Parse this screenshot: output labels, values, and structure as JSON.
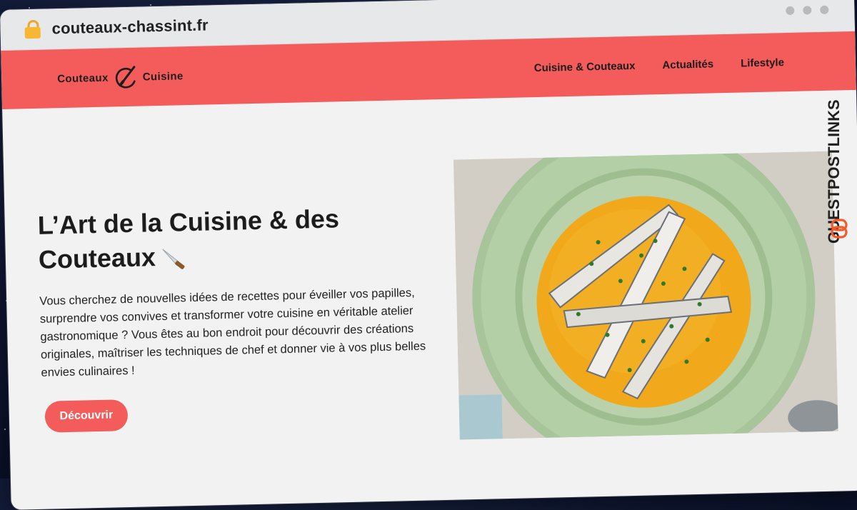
{
  "browser": {
    "url": "couteaux-chassint.fr"
  },
  "nav": {
    "logo_left": "Couteaux",
    "logo_right": "Cuisine",
    "items": [
      {
        "label": "Cuisine & Couteaux"
      },
      {
        "label": "Actualités"
      },
      {
        "label": "Lifestyle"
      }
    ]
  },
  "hero": {
    "title": "L’Art de la Cuisine & des Couteaux",
    "description": "Vous cherchez de nouvelles idées de recettes pour éveiller vos papilles, surprendre vos convives et transformer votre cuisine en véritable atelier gastronomique ? Vous êtes au bon endroit pour découvrir des créations originales, maîtriser les techniques de chef et donner vie à vos plus belles envies culinaires !",
    "cta_label": "Découvrir",
    "title_icon": "knife-icon",
    "image_icon": "dish-photo"
  },
  "watermark": {
    "text": "GUESTPOSTLINKS"
  },
  "colors": {
    "accent": "#f45b5b",
    "chrome": "#e7e8ea",
    "page_bg": "#f2f2f2"
  }
}
